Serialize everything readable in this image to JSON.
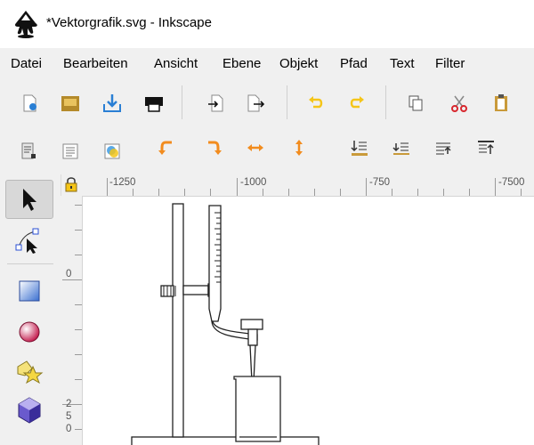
{
  "window": {
    "title": "*Vektorgrafik.svg - Inkscape"
  },
  "menu": [
    "Datei",
    "Bearbeiten",
    "Ansicht",
    "Ebene",
    "Objekt",
    "Pfad",
    "Text",
    "Filter"
  ],
  "ruler_top": [
    "-1250",
    "-1000",
    "-750",
    "-7500"
  ],
  "ruler_left": [
    "0",
    "2",
    "5",
    "0"
  ],
  "colors": {
    "accent_orange": "#f28c1e",
    "undo_yellow": "#f5c518",
    "window_bg": "#f0f0f0"
  }
}
